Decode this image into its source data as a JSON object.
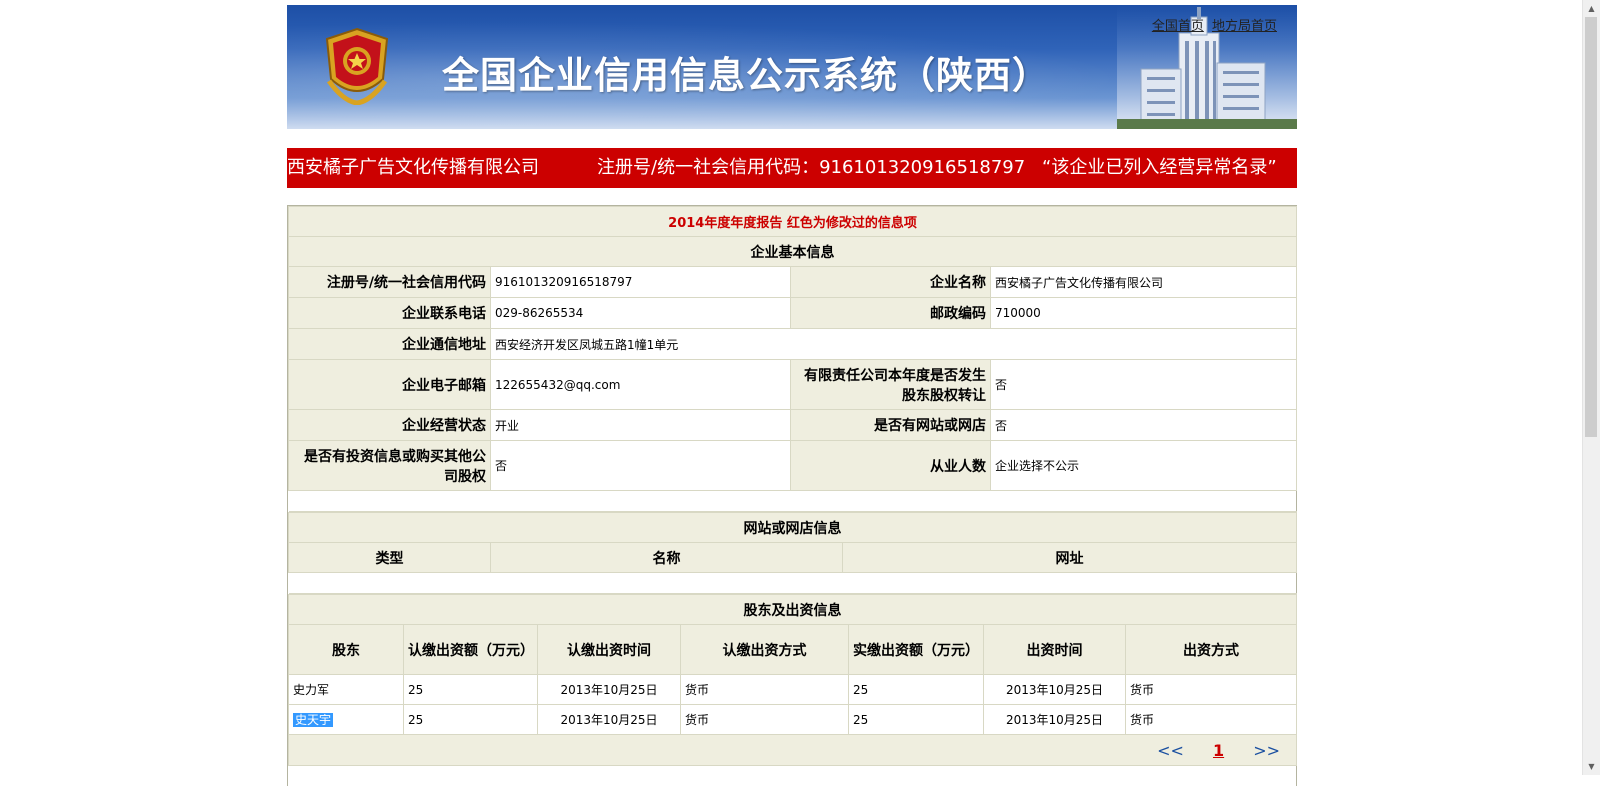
{
  "header": {
    "title": "全国企业信用信息公示系统（陕西）",
    "links": [
      "全国首页",
      "地方局首页"
    ]
  },
  "company_bar": {
    "name": "西安橘子广告文化传播有限公司",
    "code_text": "注册号/统一社会信用代码：916101320916518797",
    "status_text": "“该企业已列入经营异常名录”"
  },
  "report": {
    "title": "2014年度年度报告  红色为修改过的信息项",
    "basic_section": "企业基本信息",
    "fields": {
      "reg_no_label": "注册号/统一社会信用代码",
      "reg_no": "916101320916518797",
      "name_label": "企业名称",
      "name": "西安橘子广告文化传播有限公司",
      "phone_label": "企业联系电话",
      "phone": "029-86265534",
      "zip_label": "邮政编码",
      "zip": "710000",
      "address_label": "企业通信地址",
      "address": "西安经济开发区凤城五路1幢1单元",
      "email_label": "企业电子邮箱",
      "email": "122655432@qq.com",
      "transfer_label": "有限责任公司本年度是否发生股东股权转让",
      "transfer": "否",
      "status_label": "企业经营状态",
      "status": "开业",
      "website_label": "是否有网站或网店",
      "website": "否",
      "invest_label": "是否有投资信息或购买其他公司股权",
      "invest": "否",
      "employees_label": "从业人数",
      "employees": "企业选择不公示"
    },
    "web_section": "网站或网店信息",
    "web_headers": [
      "类型",
      "名称",
      "网址"
    ],
    "shareholder_section": "股东及出资信息",
    "shareholder_headers": [
      "股东",
      "认缴出资额（万元）",
      "认缴出资时间",
      "认缴出资方式",
      "实缴出资额（万元）",
      "出资时间",
      "出资方式"
    ],
    "shareholders": [
      [
        "史力军",
        "25",
        "2013年10月25日",
        "货币",
        "25",
        "2013年10月25日",
        "货币"
      ],
      [
        "史天宇",
        "25",
        "2013年10月25日",
        "货币",
        "25",
        "2013年10月25日",
        "货币"
      ]
    ],
    "pager": {
      "prev": "<<",
      "current": "1",
      "next": ">>"
    }
  }
}
